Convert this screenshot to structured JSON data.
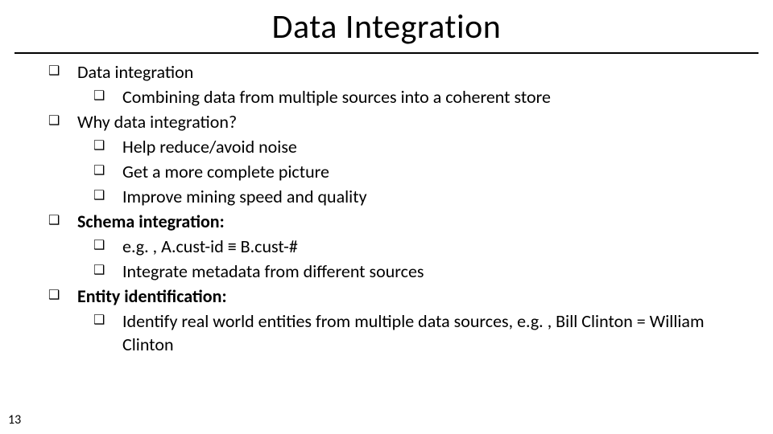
{
  "title": "Data Integration",
  "page_number": "13",
  "bullets": {
    "b1": "Data integration",
    "b1_1": "Combining data from multiple sources into a coherent store",
    "b2": "Why data integration?",
    "b2_1": "Help reduce/avoid noise",
    "b2_2": "Get a more complete picture",
    "b2_3": "Improve mining speed and quality",
    "b3": "Schema integration:",
    "b3_1": "e.g. , A.cust-id ≡ B.cust-#",
    "b3_2": "Integrate metadata from different sources",
    "b4": "Entity identification:",
    "b4_1": "Identify real world entities from multiple data sources, e.g. , Bill Clinton = William Clinton"
  }
}
